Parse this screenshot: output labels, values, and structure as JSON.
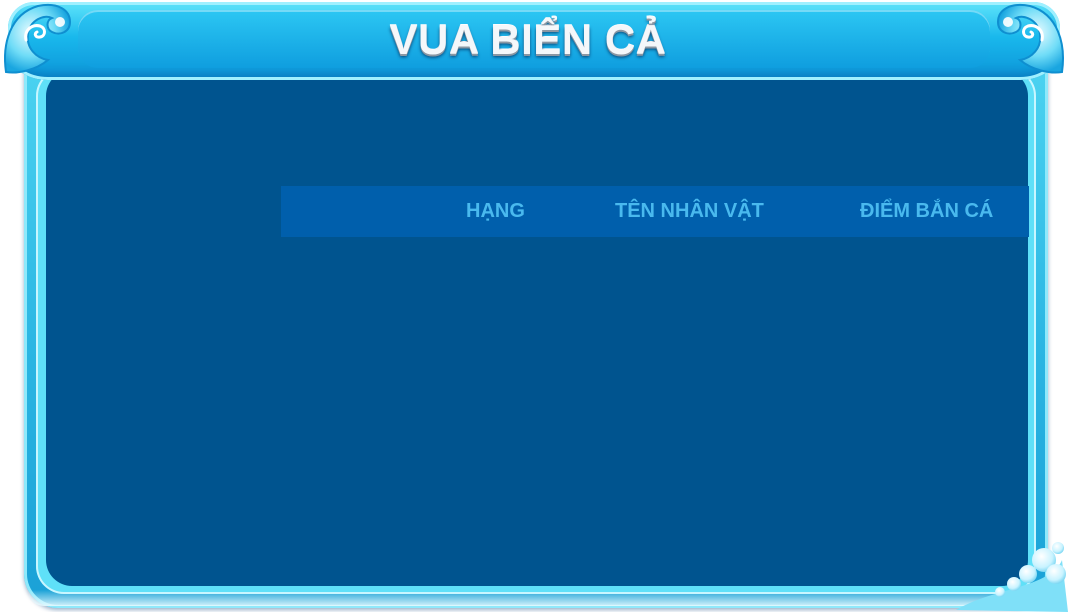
{
  "header": {
    "title": "VUA BIỂN CẢ"
  },
  "leaderboard": {
    "columns": [
      {
        "label": "HẠNG"
      },
      {
        "label": "TÊN NHÂN VẬT"
      },
      {
        "label": "ĐIỂM BẮN CÁ"
      }
    ],
    "rows": []
  },
  "colors": {
    "panel_background": "#00548f",
    "table_header_background": "#005fac",
    "column_label": "#49b9ee",
    "frame_cyan": "#2bb6e3",
    "title_silver": "#f4f7fa"
  },
  "icons": {
    "top_left_ornament": "wave-swirl-icon",
    "top_right_ornament": "wave-swirl-icon",
    "bottom_right_ornament": "bubbles-wave-icon"
  }
}
